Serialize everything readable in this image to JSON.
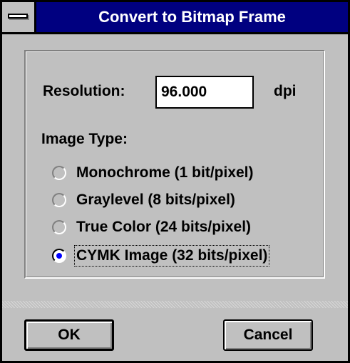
{
  "window": {
    "title": "Convert to Bitmap Frame"
  },
  "resolution": {
    "label": "Resolution:",
    "value": "96.000",
    "unit": "dpi"
  },
  "image_type": {
    "label": "Image Type:",
    "options": [
      {
        "label": "Monochrome (1 bit/pixel)",
        "selected": false
      },
      {
        "label": "Graylevel (8 bits/pixel)",
        "selected": false
      },
      {
        "label": "True Color (24 bits/pixel)",
        "selected": false
      },
      {
        "label": "CYMK Image (32 bits/pixel)",
        "selected": true
      }
    ]
  },
  "buttons": {
    "ok_label": "OK",
    "cancel_label": "Cancel"
  },
  "colors": {
    "titlebar": "#000080",
    "face": "#c0c0c0",
    "radio_dot": "#0000ff"
  }
}
